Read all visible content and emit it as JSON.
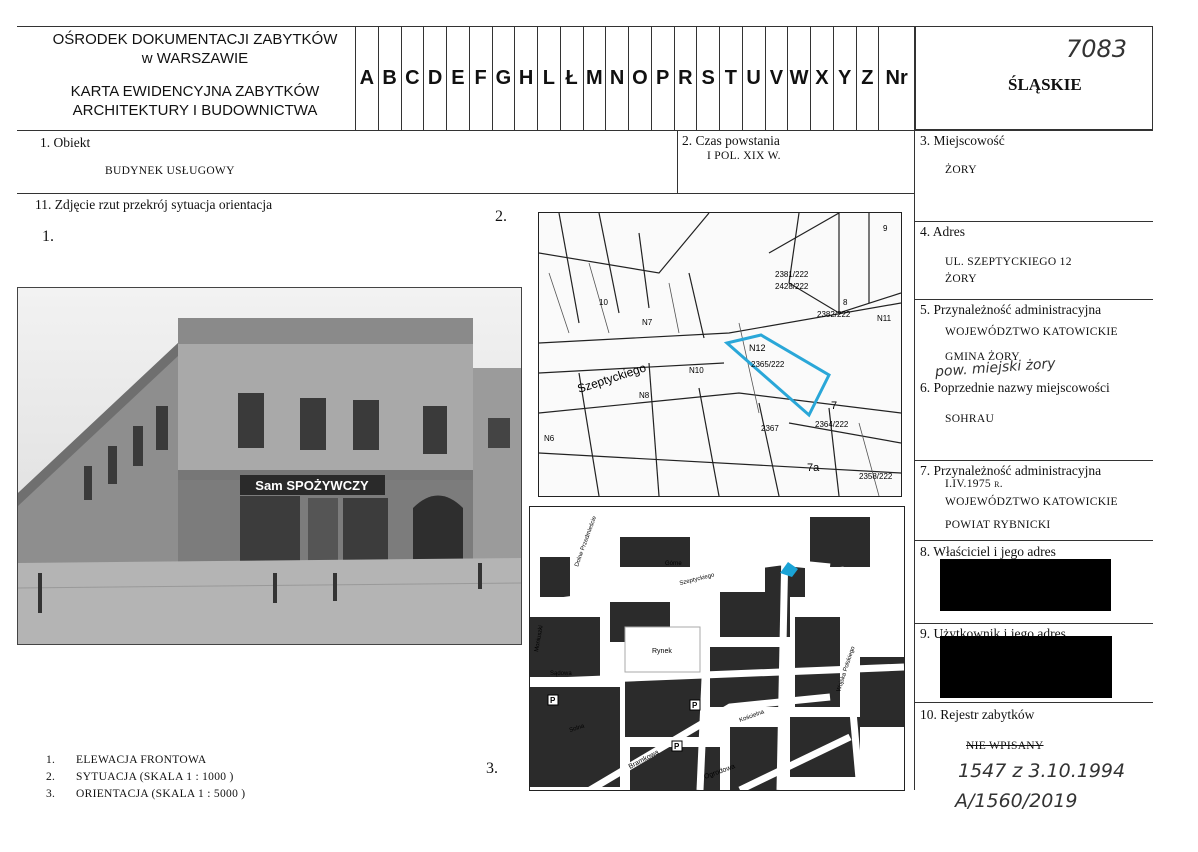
{
  "header": {
    "org_line1": "OŚRODEK DOKUMENTACJI ZABYTKÓW",
    "org_line2": "w WARSZAWIE",
    "card_line1": "KARTA EWIDENCYJNA ZABYTKÓW",
    "card_line2": "ARCHITEKTURY I BUDOWNICTWA",
    "letters": [
      "A",
      "B",
      "C",
      "D",
      "E",
      "F",
      "G",
      "H",
      "L",
      "Ł",
      "M",
      "N",
      "O",
      "P",
      "R",
      "S",
      "T",
      "U",
      "V",
      "W",
      "X",
      "Y",
      "Z"
    ],
    "nr_label": "Nr",
    "region": "ŚLĄSKIE",
    "handwritten_number": "7083"
  },
  "fields": {
    "f1_label": "1.  Obiekt",
    "f1_value": "BUDYNEK USŁUGOWY",
    "f2_label": "2.  Czas powstania",
    "f2_value": "I POL. XIX W.",
    "f3_label": "3.  Miejscowość",
    "f3_value": "ŻORY",
    "f4_label": "4.  Adres",
    "f4_value1": "UL. SZEPTYCKIEGO 12",
    "f4_value2": "ŻORY",
    "f5_label": "5.  Przynależność administracyjna",
    "f5_value1": "WOJEWÓDZTWO  KATOWICKIE",
    "f5_value2": "GMINA ŻORY",
    "f5_hand": "pow. miejski żory",
    "f6_label": "6.  Poprzednie nazwy miejscowości",
    "f6_value": "SOHRAU",
    "f7_label": "7.  Przynależność administracyjna",
    "f7_value1": "I.IV.1975 r.",
    "f7_value2": "WOJEWÓDZTWO KATOWICKIE",
    "f7_value3": "POWIAT RYBNICKI",
    "f8_label": "8.  Właściciel i jego adres",
    "f9_label": "9.  Użytkownik i jego adres",
    "f10_label": "10.  Rejestr zabytków",
    "f10_struck": "NIE WPISANY",
    "f10_hand1": "1547  z  3.10.1994",
    "f10_hand2": "A/1560/2019",
    "f11_label": "11.  Zdjęcie rzut przekrój sytuacja orientacja",
    "num1": "1.",
    "num2": "2.",
    "num3": "3."
  },
  "legend": [
    {
      "num": "1.",
      "text": "ELEWACJA FRONTOWA"
    },
    {
      "num": "2.",
      "text": "SYTUACJA  (SKALA 1 : 1000 )"
    },
    {
      "num": "3.",
      "text": "ORIENTACJA  (SKALA 1 : 5000 )"
    }
  ],
  "photo": {
    "shop_sign": "Sam  SPOŻYWCZY"
  },
  "map_situation": {
    "street": "Szeptyckiego",
    "plot_number": "N12",
    "plot_id": "2365/222",
    "labels": [
      "2381/222",
      "2428/222",
      "2382/222",
      "N11",
      "N10",
      "N8",
      "N6",
      "7",
      "7a",
      "2367",
      "2364/222",
      "2358/222",
      "8",
      "9",
      "10",
      "N7"
    ]
  },
  "map_orientation": {
    "labels": [
      "Szeptyckiego",
      "Rynek",
      "Bramkowa",
      "Ogrodowa",
      "Solna",
      "Kościelna",
      "Wojska Polskiego",
      "Moniuszki",
      "Sądowa",
      "Dolne Przedmieście",
      "Górne"
    ],
    "parking": "P",
    "highlight_color": "#1aa3d6"
  },
  "colors": {
    "plot_outline": "#2aa7d8"
  }
}
